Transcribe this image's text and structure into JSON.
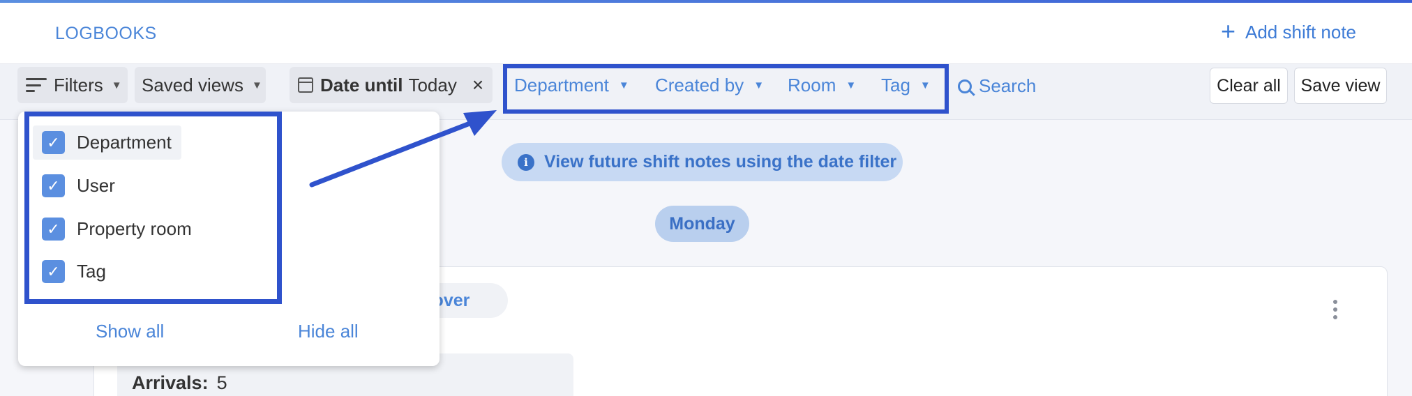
{
  "header": {
    "section_label": "LOGBOOKS",
    "add_label": "Add shift note",
    "add_icon": "plus-icon"
  },
  "toolbar": {
    "filters_label": "Filters",
    "saved_views_label": "Saved views",
    "date_filter_key": "Date until",
    "date_filter_value": "Today",
    "dim_filters": [
      {
        "label": "Department"
      },
      {
        "label": "Created by"
      },
      {
        "label": "Room"
      },
      {
        "label": "Tag"
      }
    ],
    "search_label": "Search",
    "clear_all_label": "Clear all",
    "save_view_label": "Save view"
  },
  "filters_menu": {
    "options": [
      {
        "label": "Department",
        "checked": true
      },
      {
        "label": "User",
        "checked": true
      },
      {
        "label": "Property room",
        "checked": true
      },
      {
        "label": "Tag",
        "checked": true
      }
    ],
    "show_all_label": "Show all",
    "hide_all_label": "Hide all"
  },
  "main": {
    "info_text": "View future shift notes using the date filter",
    "day_label": "Monday",
    "card": {
      "tag_fragment": "ndover",
      "arrivals_label": "Arrivals:",
      "arrivals_value": "5"
    }
  },
  "colors": {
    "accent": "#4a85d8",
    "highlight": "#2f52cc",
    "checkbox": "#5b8fe0"
  }
}
